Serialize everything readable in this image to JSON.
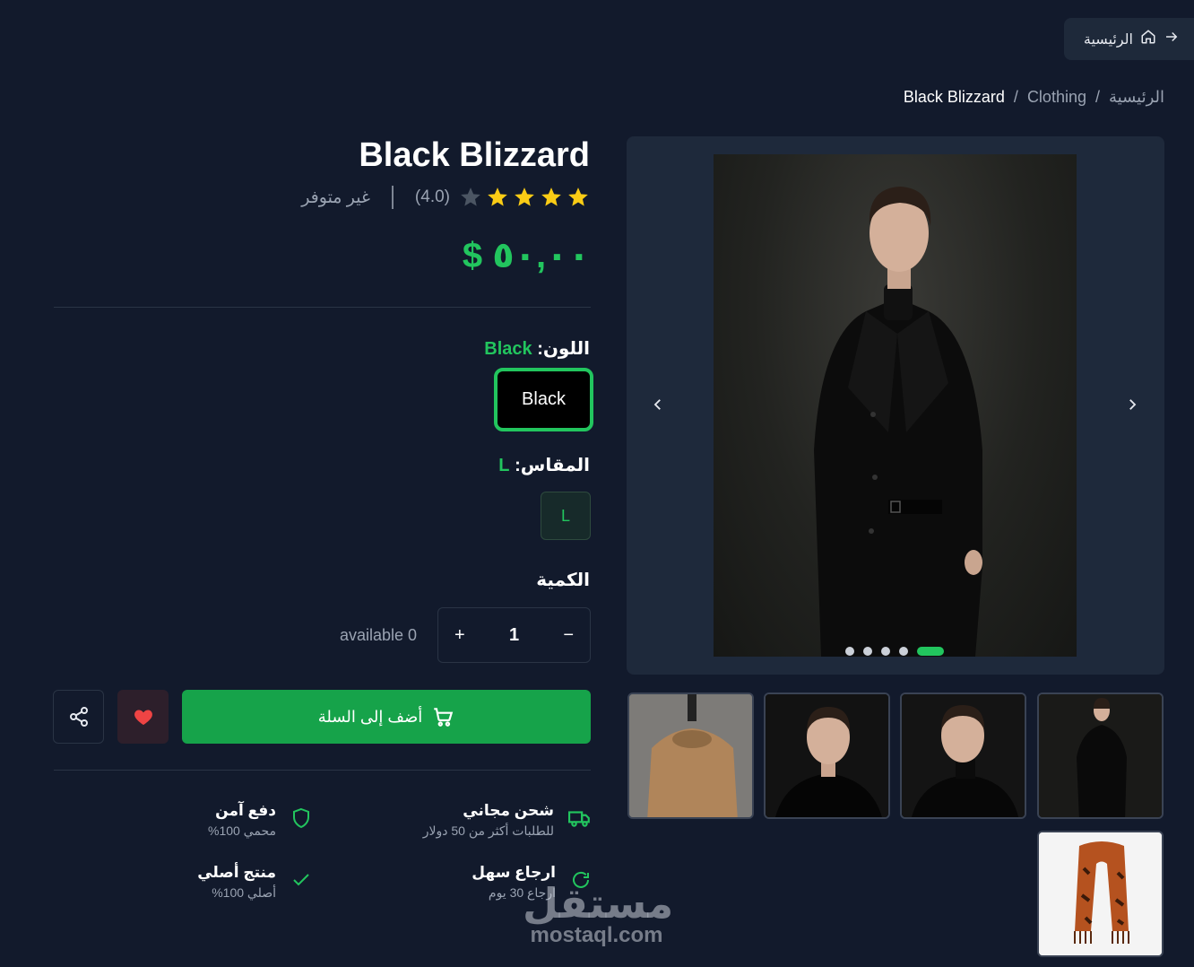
{
  "nav": {
    "home_label": "الرئيسية"
  },
  "breadcrumb": {
    "home": "الرئيسية",
    "sep": "/",
    "category": "Clothing",
    "current": "Black Blizzard"
  },
  "product": {
    "title": "Black Blizzard",
    "rating": "(4.0)",
    "stars_filled": 4,
    "stars_total": 5,
    "stock_status": "غير متوفر",
    "price": "$ ٥٠,٠٠"
  },
  "options": {
    "color_label": "اللون:",
    "color_value": "Black",
    "color_choice": "Black",
    "size_label": "المقاس:",
    "size_value": "L",
    "size_choice": "L",
    "qty_label": "الكمية",
    "qty_minus": "−",
    "qty_value": "1",
    "qty_plus": "+",
    "available": "available 0"
  },
  "actions": {
    "add_to_cart": "أضف إلى السلة"
  },
  "features": [
    {
      "title": "شحن مجاني",
      "sub": "للطلبات أكثر من 50 دولار",
      "icon": "truck-icon"
    },
    {
      "title": "دفع آمن",
      "sub": "محمي 100%",
      "icon": "shield-icon"
    },
    {
      "title": "ارجاع سهل",
      "sub": "ارجاع 30 يوم",
      "icon": "refresh-icon"
    },
    {
      "title": "منتج أصلي",
      "sub": "أصلي 100%",
      "icon": "check-icon"
    }
  ],
  "gallery": {
    "dots": 5,
    "active_dot": 5
  },
  "watermark": {
    "ar": "مستقل",
    "en": "mostaql.com"
  },
  "colors": {
    "accent": "#22c55e",
    "bg": "#121a2c",
    "panel": "#1e293b",
    "heart": "#ef4444"
  }
}
